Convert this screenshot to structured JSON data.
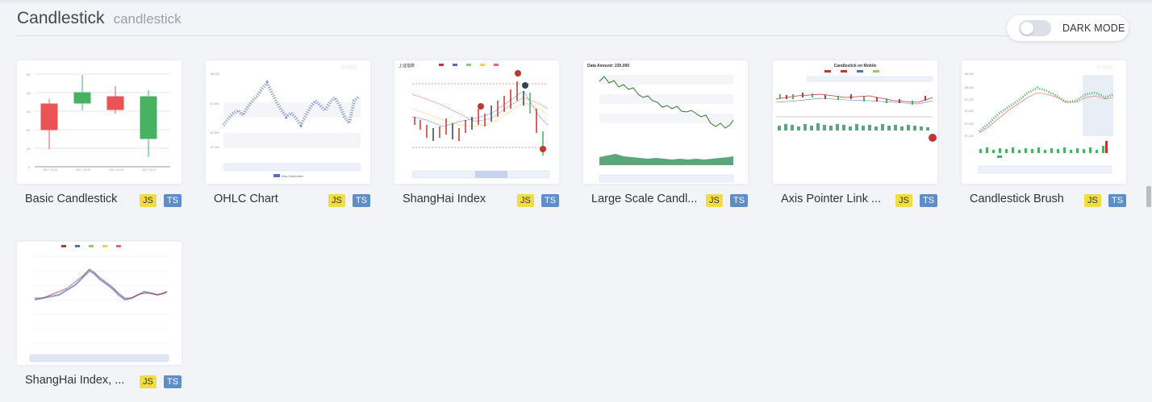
{
  "header": {
    "title": "Candlestick",
    "subtitle": "candlestick",
    "dark_mode_label": "DARK MODE"
  },
  "cards": [
    {
      "title": "Basic Candlestick",
      "js": "JS",
      "ts": "TS"
    },
    {
      "title": "OHLC Chart",
      "js": "JS",
      "ts": "TS"
    },
    {
      "title": "ShangHai Index",
      "js": "JS",
      "ts": "TS"
    },
    {
      "title": "Large Scale Candl...",
      "js": "JS",
      "ts": "TS"
    },
    {
      "title": "Axis Pointer Link ...",
      "js": "JS",
      "ts": "TS"
    },
    {
      "title": "Candlestick Brush",
      "js": "JS",
      "ts": "TS"
    },
    {
      "title": "ShangHai Index, ...",
      "js": "JS",
      "ts": "TS"
    }
  ],
  "thumbs": {
    "large_scale_caption": "Data Amount: 230,000",
    "shanghai_title": "上证指数",
    "axis_pointer_title": "Candlestick on Mobile"
  },
  "colors": {
    "up": "#47b262",
    "down": "#eb5454",
    "tag_js": "#f1dd43",
    "tag_ts": "#5d8ec9"
  }
}
